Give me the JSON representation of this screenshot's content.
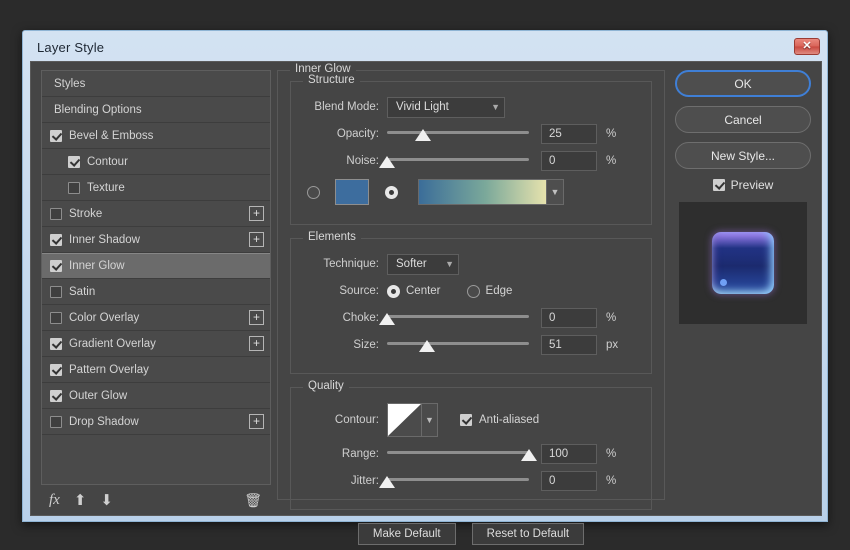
{
  "window": {
    "title": "Layer Style",
    "close_label": "✕"
  },
  "sidebar": {
    "items": [
      {
        "label": "Styles",
        "checkbox": "none",
        "indent": "plain",
        "plus": false,
        "selected": false
      },
      {
        "label": "Blending Options",
        "checkbox": "none",
        "indent": "plain",
        "plus": false,
        "selected": false
      },
      {
        "label": "Bevel & Emboss",
        "checkbox": "checked",
        "indent": "top",
        "plus": false,
        "selected": false
      },
      {
        "label": "Contour",
        "checkbox": "checked",
        "indent": "sub",
        "plus": false,
        "selected": false
      },
      {
        "label": "Texture",
        "checkbox": "unchecked",
        "indent": "sub",
        "plus": false,
        "selected": false
      },
      {
        "label": "Stroke",
        "checkbox": "unchecked",
        "indent": "top",
        "plus": true,
        "selected": false
      },
      {
        "label": "Inner Shadow",
        "checkbox": "checked",
        "indent": "top",
        "plus": true,
        "selected": false
      },
      {
        "label": "Inner Glow",
        "checkbox": "checked",
        "indent": "top",
        "plus": false,
        "selected": true
      },
      {
        "label": "Satin",
        "checkbox": "unchecked",
        "indent": "top",
        "plus": false,
        "selected": false
      },
      {
        "label": "Color Overlay",
        "checkbox": "unchecked",
        "indent": "top",
        "plus": true,
        "selected": false
      },
      {
        "label": "Gradient Overlay",
        "checkbox": "checked",
        "indent": "top",
        "plus": true,
        "selected": false
      },
      {
        "label": "Pattern Overlay",
        "checkbox": "checked",
        "indent": "top",
        "plus": false,
        "selected": false
      },
      {
        "label": "Outer Glow",
        "checkbox": "checked",
        "indent": "top",
        "plus": false,
        "selected": false
      },
      {
        "label": "Drop Shadow",
        "checkbox": "unchecked",
        "indent": "top",
        "plus": true,
        "selected": false
      }
    ],
    "toolbar": {
      "fx_label": "fx",
      "move_up_label": "⬆",
      "move_down_label": "⬇",
      "delete_label": "🗑"
    }
  },
  "main": {
    "effect_title": "Inner Glow",
    "structure": {
      "title": "Structure",
      "blend_mode_label": "Blend Mode:",
      "blend_mode_value": "Vivid Light",
      "opacity_label": "Opacity:",
      "opacity_value": "25",
      "opacity_unit": "%",
      "opacity_pct": 25,
      "noise_label": "Noise:",
      "noise_value": "0",
      "noise_unit": "%",
      "noise_pct": 0,
      "fill_mode": "gradient",
      "solid_color": "#3d6d9e",
      "gradient_start": "#3b6d99",
      "gradient_mid": "#7aa89a",
      "gradient_end": "#e6e2ad"
    },
    "elements": {
      "title": "Elements",
      "technique_label": "Technique:",
      "technique_value": "Softer",
      "source_label": "Source:",
      "source_center_label": "Center",
      "source_edge_label": "Edge",
      "source_value": "Center",
      "choke_label": "Choke:",
      "choke_value": "0",
      "choke_unit": "%",
      "choke_pct": 0,
      "size_label": "Size:",
      "size_value": "51",
      "size_unit": "px",
      "size_pct": 28
    },
    "quality": {
      "title": "Quality",
      "contour_label": "Contour:",
      "anti_aliased_label": "Anti-aliased",
      "anti_aliased_checked": true,
      "range_label": "Range:",
      "range_value": "100",
      "range_unit": "%",
      "range_pct": 100,
      "jitter_label": "Jitter:",
      "jitter_value": "0",
      "jitter_unit": "%",
      "jitter_pct": 0
    },
    "make_default_label": "Make Default",
    "reset_default_label": "Reset to Default"
  },
  "right": {
    "ok_label": "OK",
    "cancel_label": "Cancel",
    "new_style_label": "New Style...",
    "preview_label": "Preview",
    "preview_checked": true
  }
}
